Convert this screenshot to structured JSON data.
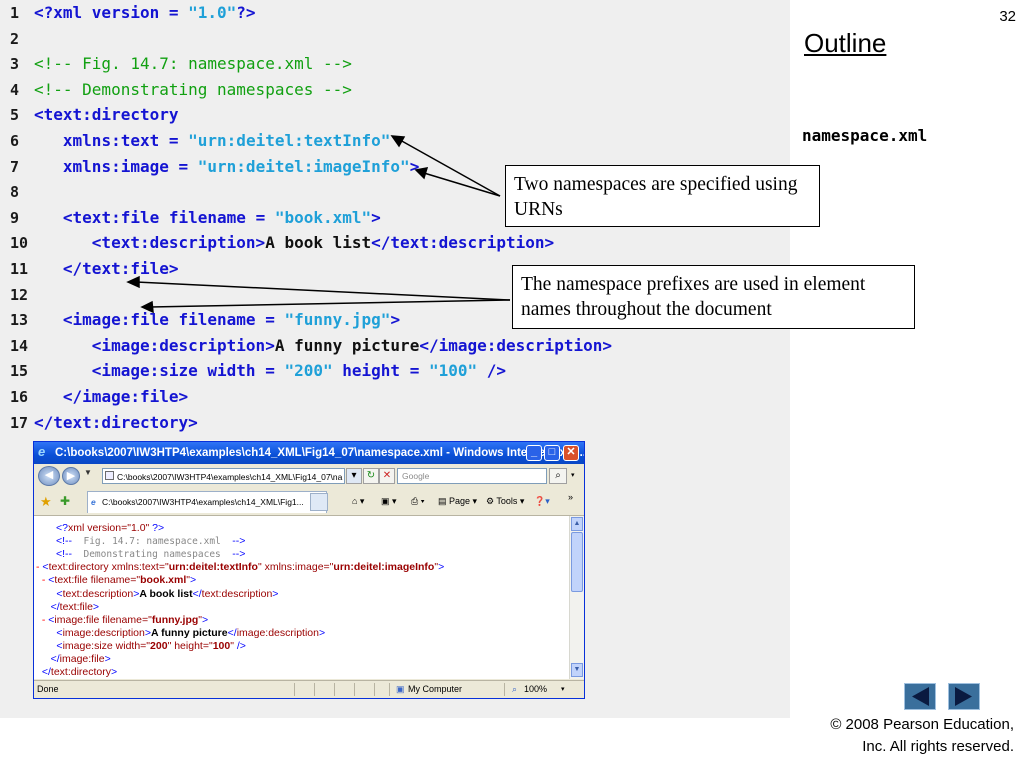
{
  "slide_number": "32",
  "outline_label": "Outline",
  "file_label": "namespace.xml",
  "code_lines": [
    {
      "n": "1",
      "html": "<span class=\"b\">&lt;?xml version = </span><span class=\"s\">\"1.0\"</span><span class=\"b\">?&gt;</span>"
    },
    {
      "n": "2",
      "html": ""
    },
    {
      "n": "3",
      "html": "<span class=\"c\">&lt;!-- Fig. 14.7: namespace.xml --&gt;</span>"
    },
    {
      "n": "4",
      "html": "<span class=\"c\">&lt;!-- Demonstrating namespaces --&gt;</span>"
    },
    {
      "n": "5",
      "html": "<span class=\"b\">&lt;text:directory</span>"
    },
    {
      "n": "6",
      "html": "   <span class=\"b\">xmlns:text = </span><span class=\"s\">\"urn:deitel:textInfo\"</span>"
    },
    {
      "n": "7",
      "html": "   <span class=\"b\">xmlns:image = </span><span class=\"s\">\"urn:deitel:imageInfo\"</span><span class=\"b\">&gt;</span>"
    },
    {
      "n": "8",
      "html": ""
    },
    {
      "n": "9",
      "html": "   <span class=\"b\">&lt;text:file filename = </span><span class=\"s\">\"book.xml\"</span><span class=\"b\">&gt;</span>"
    },
    {
      "n": "10",
      "html": "      <span class=\"b\">&lt;text:description&gt;</span><span class=\"t\">A book list</span><span class=\"b\">&lt;/text:description&gt;</span>"
    },
    {
      "n": "11",
      "html": "   <span class=\"b\">&lt;/text:file&gt;</span>"
    },
    {
      "n": "12",
      "html": ""
    },
    {
      "n": "13",
      "html": "   <span class=\"b\">&lt;image:file filename = </span><span class=\"s\">\"funny.jpg\"</span><span class=\"b\">&gt;</span>"
    },
    {
      "n": "14",
      "html": "      <span class=\"b\">&lt;image:description&gt;</span><span class=\"t\">A funny picture</span><span class=\"b\">&lt;/image:description&gt;</span>"
    },
    {
      "n": "15",
      "html": "      <span class=\"b\">&lt;image:size width = </span><span class=\"s\">\"200\"</span><span class=\"b\"> height = </span><span class=\"s\">\"100\"</span><span class=\"b\"> /&gt;</span>"
    },
    {
      "n": "16",
      "html": "   <span class=\"b\">&lt;/image:file&gt;</span>"
    },
    {
      "n": "17",
      "html": "<span class=\"b\">&lt;/text:directory&gt;</span>"
    }
  ],
  "callouts": {
    "urns": "Two namespaces are specified using URNs",
    "prefixes": "The namespace prefixes are used in element names throughout the document"
  },
  "browser": {
    "title": "C:\\books\\2007\\IW3HTP4\\examples\\ch14_XML\\Fig14_07\\namespace.xml - Windows Internet Expl...",
    "address": "C:\\books\\2007\\IW3HTP4\\examples\\ch14_XML\\Fig14_07\\na",
    "search_placeholder": "Google",
    "tab_label": "C:\\books\\2007\\IW3HTP4\\examples\\ch14_XML\\Fig1...",
    "page_menu": "Page",
    "tools_menu": "Tools",
    "status_text": "Done",
    "zone_text": "My Computer",
    "zoom_text": "100%",
    "xml_lines": [
      "<span class=\"m\">&lt;?</span><span class=\"e\">xml version=\"1.0\"</span><span class=\"m\"> ?&gt;</span>",
      "<span class=\"m\">&lt;!--</span><span class=\"cm\">  Fig. 14.7: namespace.xml  </span><span class=\"m\">--&gt;</span>",
      "<span class=\"m\">&lt;!--</span><span class=\"cm\">  Demonstrating namespaces  </span><span class=\"m\">--&gt;</span>",
      "<span class=\"dash\">-</span> <span class=\"m\">&lt;</span><span class=\"e\">text:directory xmlns:text=\"</span><span class=\"v\">urn:deitel:textInfo</span><span class=\"e\">\" xmlns:image=\"</span><span class=\"v\">urn:deitel:imageInfo</span><span class=\"e\">\"</span><span class=\"m\">&gt;</span>",
      "  <span class=\"dash\">-</span> <span class=\"m\">&lt;</span><span class=\"e\">text:file filename=\"</span><span class=\"v\">book.xml</span><span class=\"e\">\"</span><span class=\"m\">&gt;</span>",
      "       <span class=\"m\">&lt;</span><span class=\"e\">text:description</span><span class=\"m\">&gt;</span><span class=\"k\">A book list</span><span class=\"m\">&lt;/</span><span class=\"e\">text:description</span><span class=\"m\">&gt;</span>",
      "     <span class=\"m\">&lt;/</span><span class=\"e\">text:file</span><span class=\"m\">&gt;</span>",
      "  <span class=\"dash\">-</span> <span class=\"m\">&lt;</span><span class=\"e\">image:file filename=\"</span><span class=\"v\">funny.jpg</span><span class=\"e\">\"</span><span class=\"m\">&gt;</span>",
      "       <span class=\"m\">&lt;</span><span class=\"e\">image:description</span><span class=\"m\">&gt;</span><span class=\"k\">A funny picture</span><span class=\"m\">&lt;/</span><span class=\"e\">image:description</span><span class=\"m\">&gt;</span>",
      "       <span class=\"m\">&lt;</span><span class=\"e\">image:size width=\"</span><span class=\"v\">200</span><span class=\"e\">\" height=\"</span><span class=\"v\">100</span><span class=\"e\">\"</span><span class=\"m\"> /&gt;</span>",
      "     <span class=\"m\">&lt;/</span><span class=\"e\">image:file</span><span class=\"m\">&gt;</span>",
      "  <span class=\"m\">&lt;/</span><span class=\"e\">text:directory</span><span class=\"m\">&gt;</span>"
    ]
  },
  "copyright_lines": [
    "© 2008 Pearson Education,",
    "Inc.  All rights reserved."
  ],
  "colors": {
    "panel": "#efefef",
    "code_blue": "#1414d2",
    "string": "#1fa0d8",
    "comment": "#11a011",
    "titlebar": "#0a4fd6",
    "nav_arrow": "#3a6f9c"
  }
}
